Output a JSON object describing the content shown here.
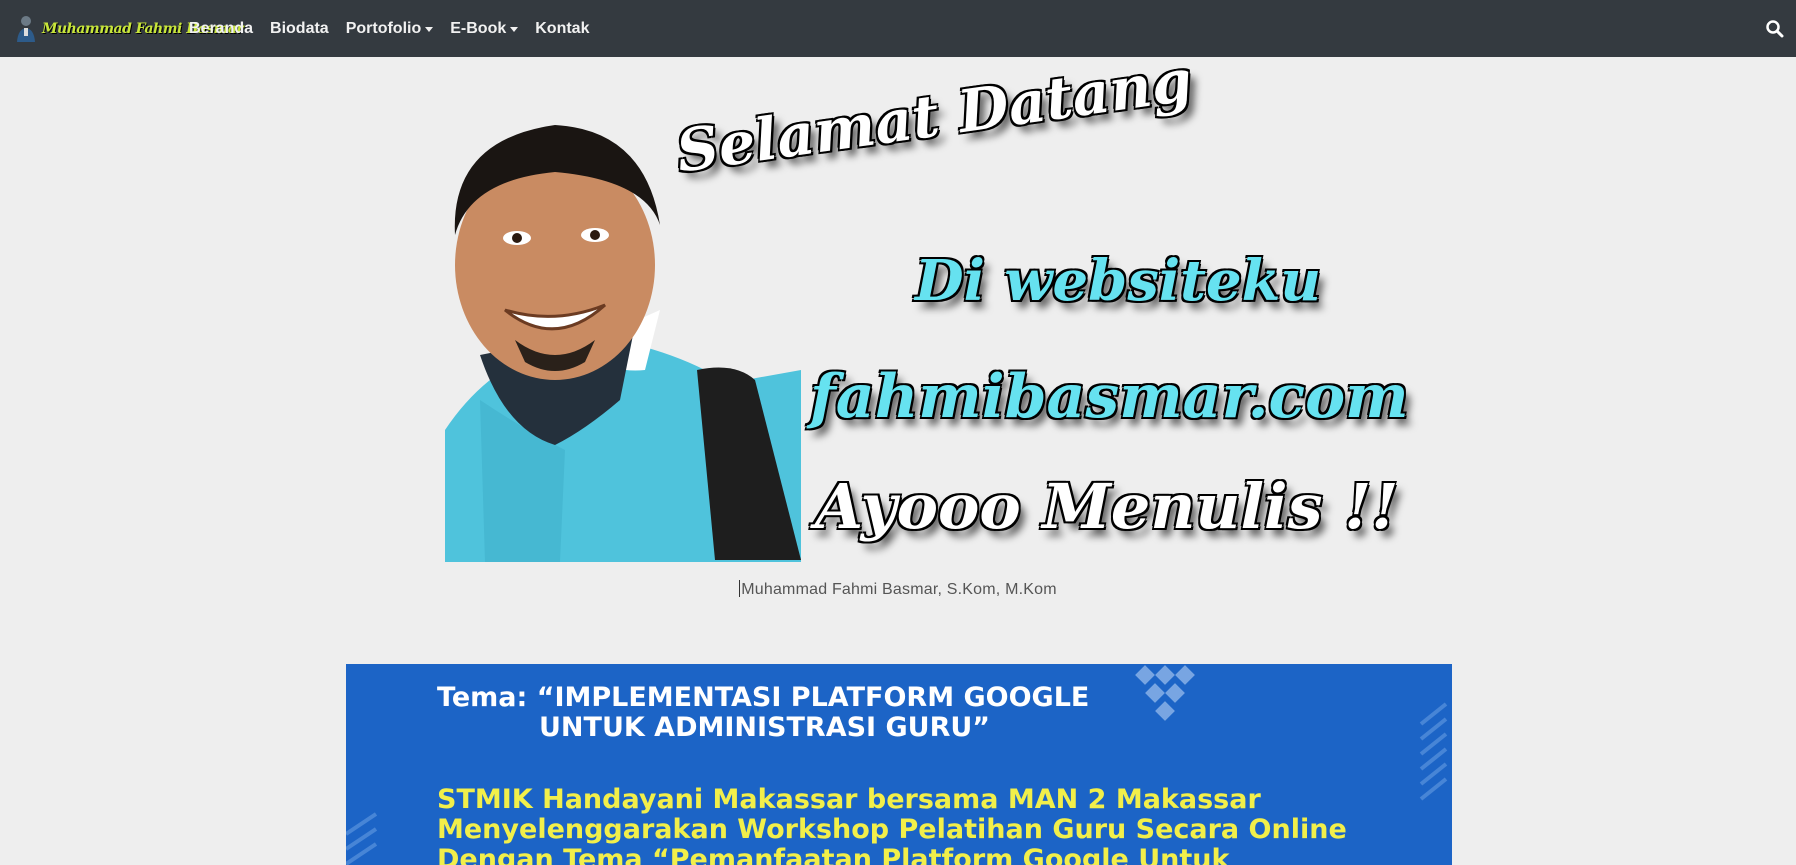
{
  "brand": {
    "name": "Muhammad Fahmi Basmar"
  },
  "nav": {
    "items": [
      {
        "label": "Beranda",
        "dropdown": false
      },
      {
        "label": "Biodata",
        "dropdown": false
      },
      {
        "label": "Portofolio",
        "dropdown": true
      },
      {
        "label": "E-Book",
        "dropdown": true
      },
      {
        "label": "Kontak",
        "dropdown": false
      }
    ],
    "search_icon": "search-icon"
  },
  "hero": {
    "line1": "Selamat Datang",
    "line2": "Di websiteku",
    "line3": "fahmibasmar.com",
    "line4": "Ayooo Menulis !!",
    "caption": "Muhammad Fahmi Basmar, S.Kom, M.Kom"
  },
  "banner": {
    "line1": "Tema: “IMPLEMENTASI PLATFORM GOOGLE",
    "line2": "UNTUK ADMINISTRASI GURU”",
    "line3": "STMIK Handayani Makassar bersama MAN 2 Makassar",
    "line4": "Menyelenggarakan Workshop Pelatihan Guru Secara Online",
    "line5": "Dengan Tema “Pemanfaatan Platform Google Untuk"
  },
  "colors": {
    "navbar": "#343a40",
    "page_bg": "#eeeeee",
    "banner_bg": "#1c64c6",
    "banner_highlight": "#f2ef4a",
    "hero_cyan": "#66e2f0"
  }
}
